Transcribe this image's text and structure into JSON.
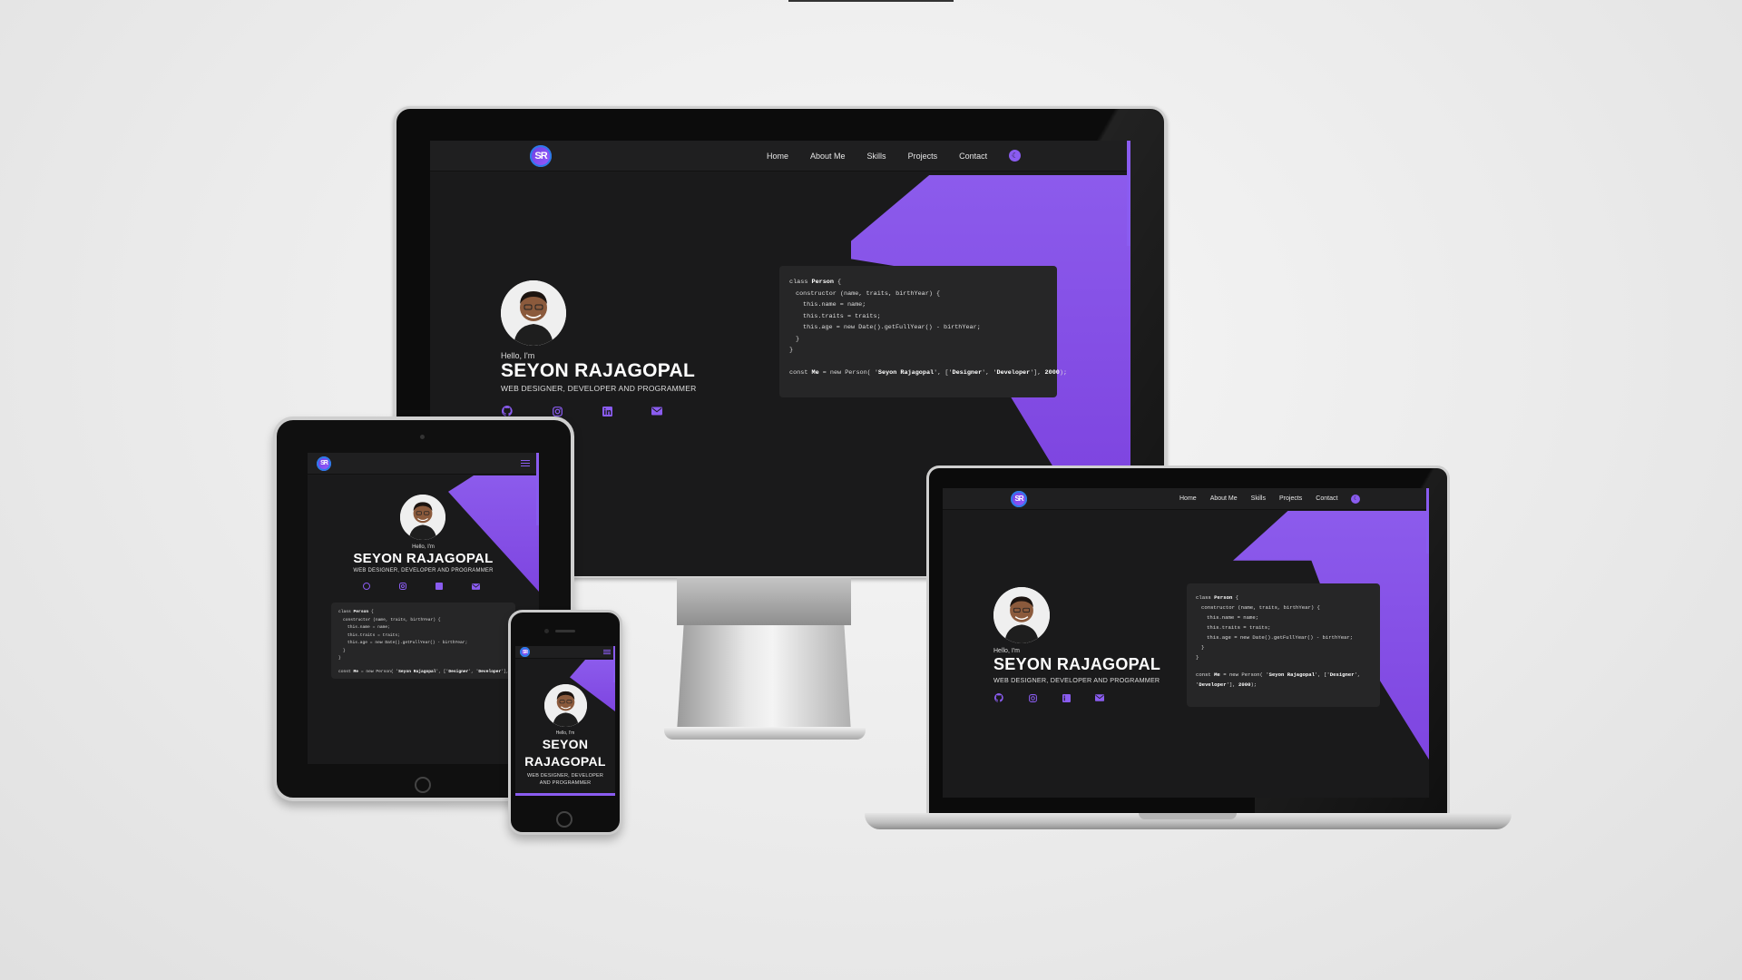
{
  "site": {
    "logo": "SR",
    "nav": [
      "Home",
      "About Me",
      "Skills",
      "Projects",
      "Contact"
    ],
    "hello": "Hello, I'm",
    "name": "SEYON RAJAGOPAL",
    "name_line1": "SEYON",
    "name_line2": "RAJAGOPAL",
    "role": "WEB DESIGNER, DEVELOPER AND PROGRAMMER",
    "role_line1": "WEB DESIGNER, DEVELOPER",
    "role_line2": "AND PROGRAMMER",
    "code": {
      "l1_pre": "class ",
      "l1_b": "Person",
      "l1_post": " {",
      "l2": "constructor (name, traits, birthYear) {",
      "l3": "this.name = name;",
      "l4": "this.traits = traits;",
      "l5": "this.age = new Date().getFullYear() - birthYear;",
      "l6": "}",
      "l7": "}",
      "l8_a": "const ",
      "l8_b": "Me",
      "l8_c": " = new Person( '",
      "l8_d": "Seyon Rajagopal",
      "l8_e": "', ['",
      "l8_f": "Designer",
      "l8_g": "', '",
      "l8_h": "Developer",
      "l8_i": "'], ",
      "l8_j": "2000",
      "l8_k": ");"
    },
    "icons": [
      "github-icon",
      "instagram-icon",
      "linkedin-icon",
      "mail-icon"
    ]
  },
  "colors": {
    "accent": "#8a5cf0",
    "site_bg": "#1a1a1b",
    "code_bg": "#262627",
    "page_bg": "#ebebeb"
  }
}
